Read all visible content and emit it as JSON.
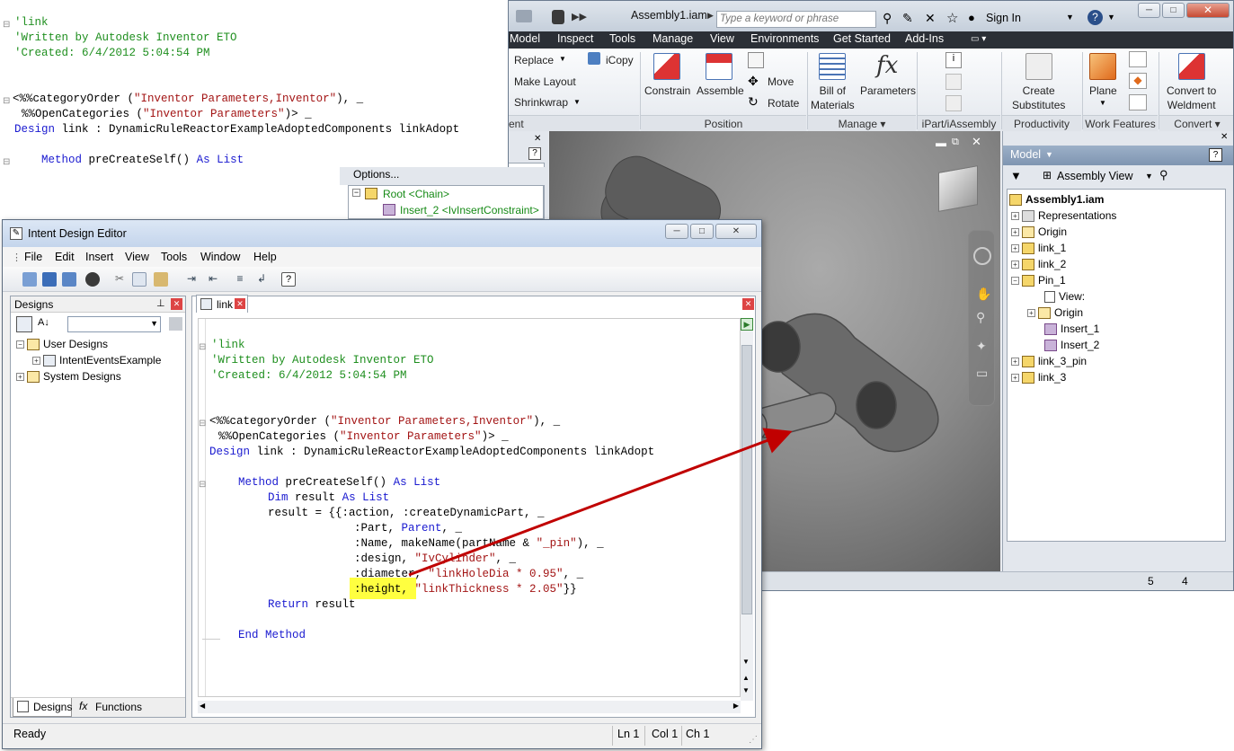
{
  "bg_code": {
    "line1": "'link",
    "line2": "'Written by Autodesk Inventor ETO",
    "line3": "'Created: 6/4/2012 5:04:54 PM",
    "line4_a": "<%%categoryOrder (",
    "line4_b": "\"Inventor Parameters,Inventor\"",
    "line4_c": "), _",
    "line5_a": "%%OpenCategories (",
    "line5_b": "\"Inventor Parameters\"",
    "line5_c": ")> _",
    "line6_kw": "Design",
    "line6_a": "link : DynamicRuleReactorExampleAdoptedComponents linkAdopt",
    "line7_kw": "Method",
    "line7_a": "preCreateSelf()",
    "line7_kw2": "As List"
  },
  "inventor": {
    "title": "Assembly1.iam",
    "search_placeholder": "Type a keyword or phrase",
    "sign_in": "Sign In",
    "menu": [
      "Model",
      "Inspect",
      "Tools",
      "Manage",
      "View",
      "Environments",
      "Get Started",
      "Add-Ins"
    ],
    "ribbon": {
      "replace": "Replace",
      "icopy": "iCopy",
      "make_layout": "Make Layout",
      "shrinkwrap": "Shrinkwrap",
      "constrain": "Constrain",
      "assemble": "Assemble",
      "move": "Move",
      "rotate": "Rotate",
      "bom_1": "Bill of",
      "bom_2": "Materials",
      "parameters": "Parameters",
      "create_1": "Create",
      "create_2": "Substitutes",
      "plane": "Plane",
      "convert_1": "Convert to",
      "convert_2": "Weldment",
      "groups": {
        "component": "ent",
        "position": "Position",
        "manage": "Manage",
        "ipart": "iPart/iAssembly",
        "productivity": "Productivity",
        "work_features": "Work Features",
        "convert": "Convert"
      }
    },
    "browser": {
      "options": "Options...",
      "root": "Root <Chain>",
      "insert": "Insert_2 <IvInsertConstraint>"
    },
    "model_panel": {
      "title": "Model",
      "view": "Assembly View",
      "tree": [
        "Assembly1.iam",
        "Representations",
        "Origin",
        "link_1",
        "link_2",
        "Pin_1",
        "View:",
        "Origin",
        "Insert_1",
        "Insert_2",
        "link_3_pin",
        "link_3"
      ]
    },
    "status": {
      "a": "5",
      "b": "4"
    }
  },
  "ide": {
    "title": "Intent Design Editor",
    "menu": [
      "File",
      "Edit",
      "Insert",
      "View",
      "Tools",
      "Window",
      "Help"
    ],
    "designs_title": "Designs",
    "tree": [
      "User Designs",
      "IntentEventsExample",
      "System Designs"
    ],
    "tabs_bottom": [
      "Designs",
      "Functions"
    ],
    "editor_tab": "link",
    "status": {
      "ready": "Ready",
      "ln": "Ln 1",
      "col": "Col 1",
      "ch": "Ch 1"
    },
    "code": {
      "c1": "'link",
      "c2": "'Written by Autodesk Inventor ETO",
      "c3": "'Created: 6/4/2012 5:04:54 PM",
      "l4a": "<%%categoryOrder (",
      "l4b": "\"Inventor Parameters,Inventor\"",
      "l4c": "), _",
      "l5a": "%%OpenCategories (",
      "l5b": "\"Inventor Parameters\"",
      "l5c": ")> _",
      "l6kw": "Design",
      "l6a": "link : DynamicRuleReactorExampleAdoptedComponents linkAdopt",
      "l7kw": "Method",
      "l7a": "preCreateSelf()",
      "l7kw2": "As List",
      "l8kw": "Dim",
      "l8a": "result",
      "l8kw2": "As List",
      "l9a": "result = {{:action, :createDynamicPart, _",
      "l10a": ":Part,",
      "l10kw": "Parent",
      "l10b": ", _",
      "l11a": ":Name, makeName(partName &",
      "l11s": "\"_pin\"",
      "l11b": "), _",
      "l12a": ":design,",
      "l12s": "\"IvCylinder\"",
      "l12b": ", _",
      "l13a": ":diameter,",
      "l13s": "\"linkHoleDia * 0.95\"",
      "l13b": ", _",
      "l14a": ":height,",
      "l14s": "\"linkThickness * 2.05\"",
      "l14b": "}}",
      "l15kw": "Return",
      "l15a": "result",
      "l16kw": "End Method"
    }
  },
  "colors": {
    "comment": "#1f8f1f",
    "keyword": "#1a1ad0",
    "string": "#a31515",
    "highlight": "#ffff40",
    "arrow": "#c00000"
  }
}
